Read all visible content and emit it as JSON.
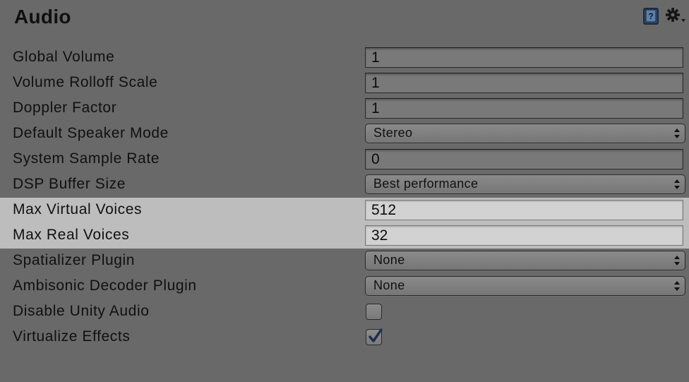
{
  "panel": {
    "title": "Audio",
    "icons": [
      "help-book-icon",
      "gear-icon"
    ]
  },
  "settings": [
    {
      "label": "Global Volume",
      "type": "text",
      "value": "1"
    },
    {
      "label": "Volume Rolloff Scale",
      "type": "text",
      "value": "1"
    },
    {
      "label": "Doppler Factor",
      "type": "text",
      "value": "1"
    },
    {
      "label": "Default Speaker Mode",
      "type": "dropdown",
      "value": "Stereo"
    },
    {
      "label": "System Sample Rate",
      "type": "text",
      "value": "0"
    },
    {
      "label": "DSP Buffer Size",
      "type": "dropdown",
      "value": "Best performance"
    },
    {
      "label": "Max Virtual Voices",
      "type": "text",
      "value": "512",
      "highlighted": true
    },
    {
      "label": "Max Real Voices",
      "type": "text",
      "value": "32",
      "highlighted": true
    },
    {
      "label": "Spatializer Plugin",
      "type": "dropdown",
      "value": "None"
    },
    {
      "label": "Ambisonic Decoder Plugin",
      "type": "dropdown",
      "value": "None"
    },
    {
      "label": "Disable Unity Audio",
      "type": "checkbox",
      "checked": false
    },
    {
      "label": "Virtualize Effects",
      "type": "checkbox",
      "checked": true
    }
  ],
  "colors": {
    "background": "#696969",
    "highlight_row": "#bdbdbd",
    "field_bg": "#797979",
    "highlight_field_bg": "#d2d2d2",
    "check_color": "#1f2d4d"
  }
}
